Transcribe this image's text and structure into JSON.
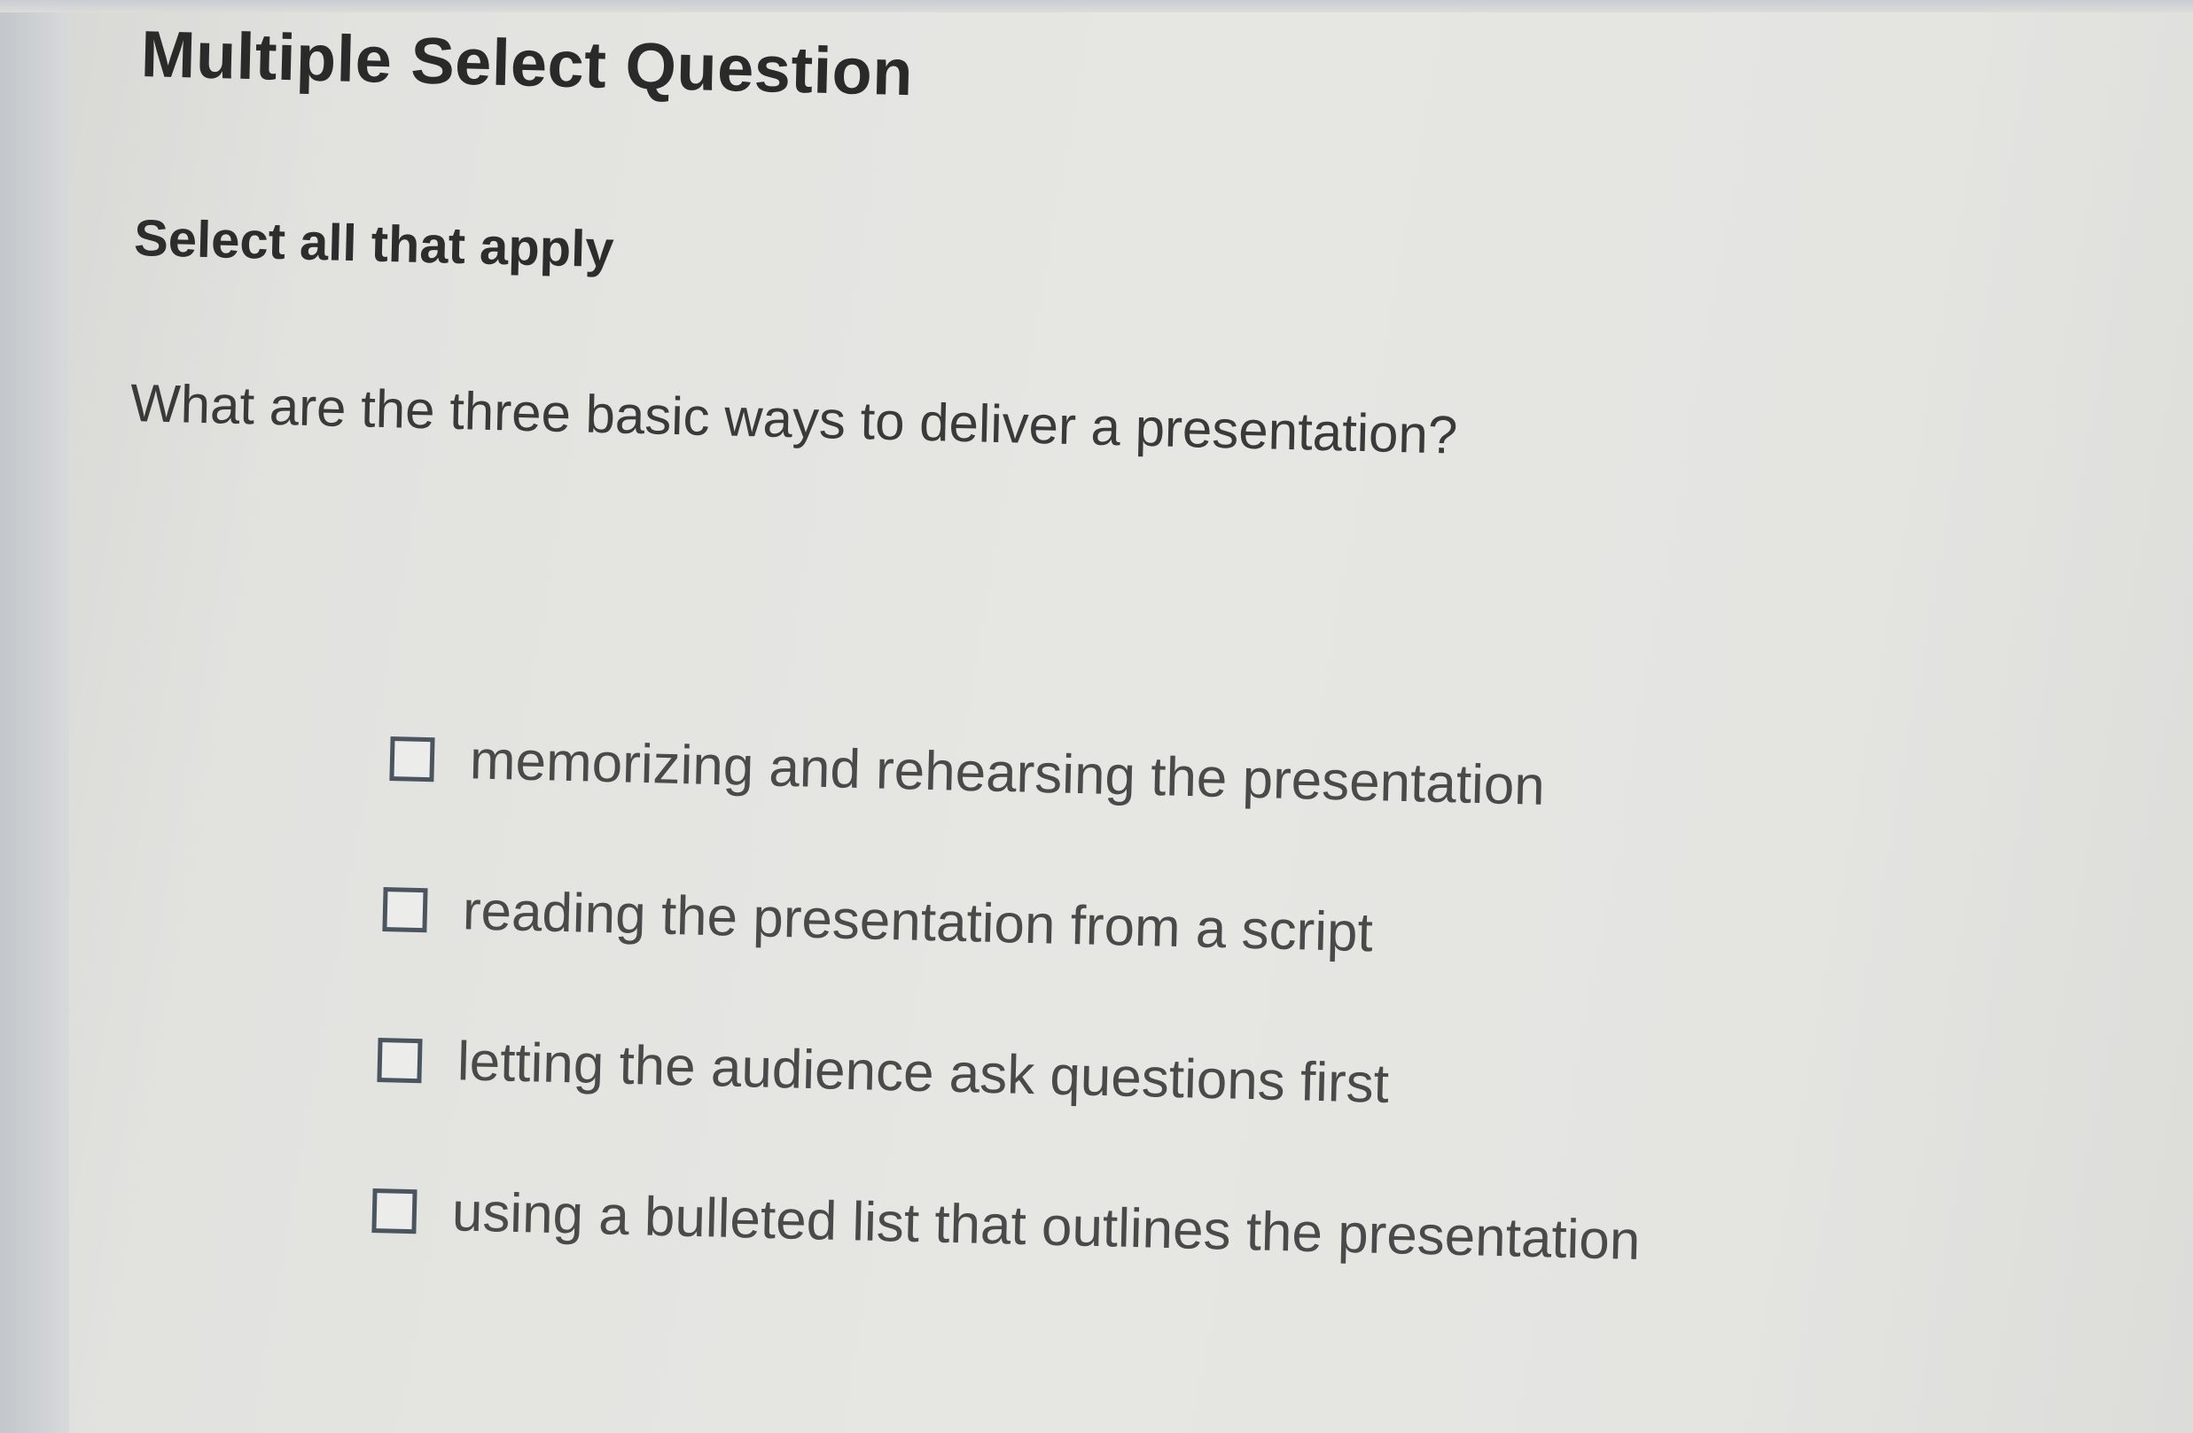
{
  "question": {
    "type_title": "Multiple Select Question",
    "instruction": "Select all that apply",
    "prompt": "What are the three basic ways to deliver a presentation?"
  },
  "options": [
    {
      "label": "memorizing and rehearsing the presentation",
      "checked": false
    },
    {
      "label": "reading the presentation from a script",
      "checked": false
    },
    {
      "label": "letting the audience ask questions first",
      "checked": false
    },
    {
      "label": "using a bulleted list that outlines the presentation",
      "checked": false
    }
  ],
  "colors": {
    "background": "#e4e4e1",
    "text_dark": "#2a2a2a",
    "option_text": "#4a4a4a",
    "checkbox_border": "#4a5560"
  }
}
